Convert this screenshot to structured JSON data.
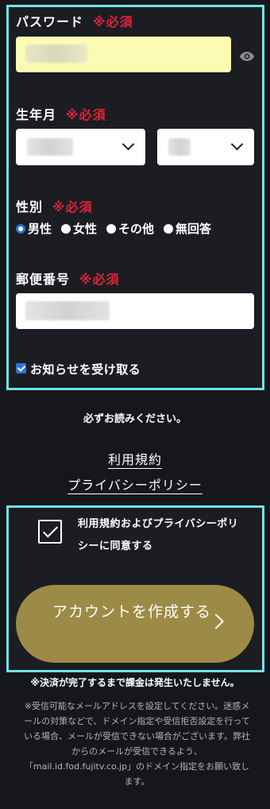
{
  "password": {
    "label": "パスワード",
    "required": "※必須"
  },
  "birth": {
    "label": "生年月",
    "required": "※必須"
  },
  "gender": {
    "label": "性別",
    "required": "※必須",
    "options": [
      "男性",
      "女性",
      "その他",
      "無回答"
    ],
    "selected": "男性"
  },
  "postal": {
    "label": "郵便番号",
    "required": "※必須"
  },
  "newsletter": {
    "label": "お知らせを受け取る",
    "checked": true
  },
  "read_notice": "必ずお読みください。",
  "links": {
    "terms": "利用規約",
    "privacy": "プライバシーポリシー"
  },
  "agree": {
    "label": "利用規約およびプライバシーポリシーに同意する",
    "checked": true
  },
  "create_button": {
    "label": "アカウントを作成する"
  },
  "billing_note": "※決済が完了するまで課金は発生いたしません。",
  "email_note": "※受信可能なメールアドレスを設定してください。迷惑メールの対策などで、ドメイン指定や受信拒否設定を行っている場合、メールが受信できない場合がございます。弊社からのメールが受信できるよう、「mail.id.fod.fujitv.co.jp」のドメイン指定をお願い致します。",
  "icons": {
    "password_toggle": "eye-icon",
    "select": "chevron-down-icon",
    "submit": "chevron-right-icon"
  },
  "colors": {
    "accent": "#6fe3e6",
    "required": "#e0223a",
    "button": "#9c8b46",
    "check": "#2a73d8"
  }
}
